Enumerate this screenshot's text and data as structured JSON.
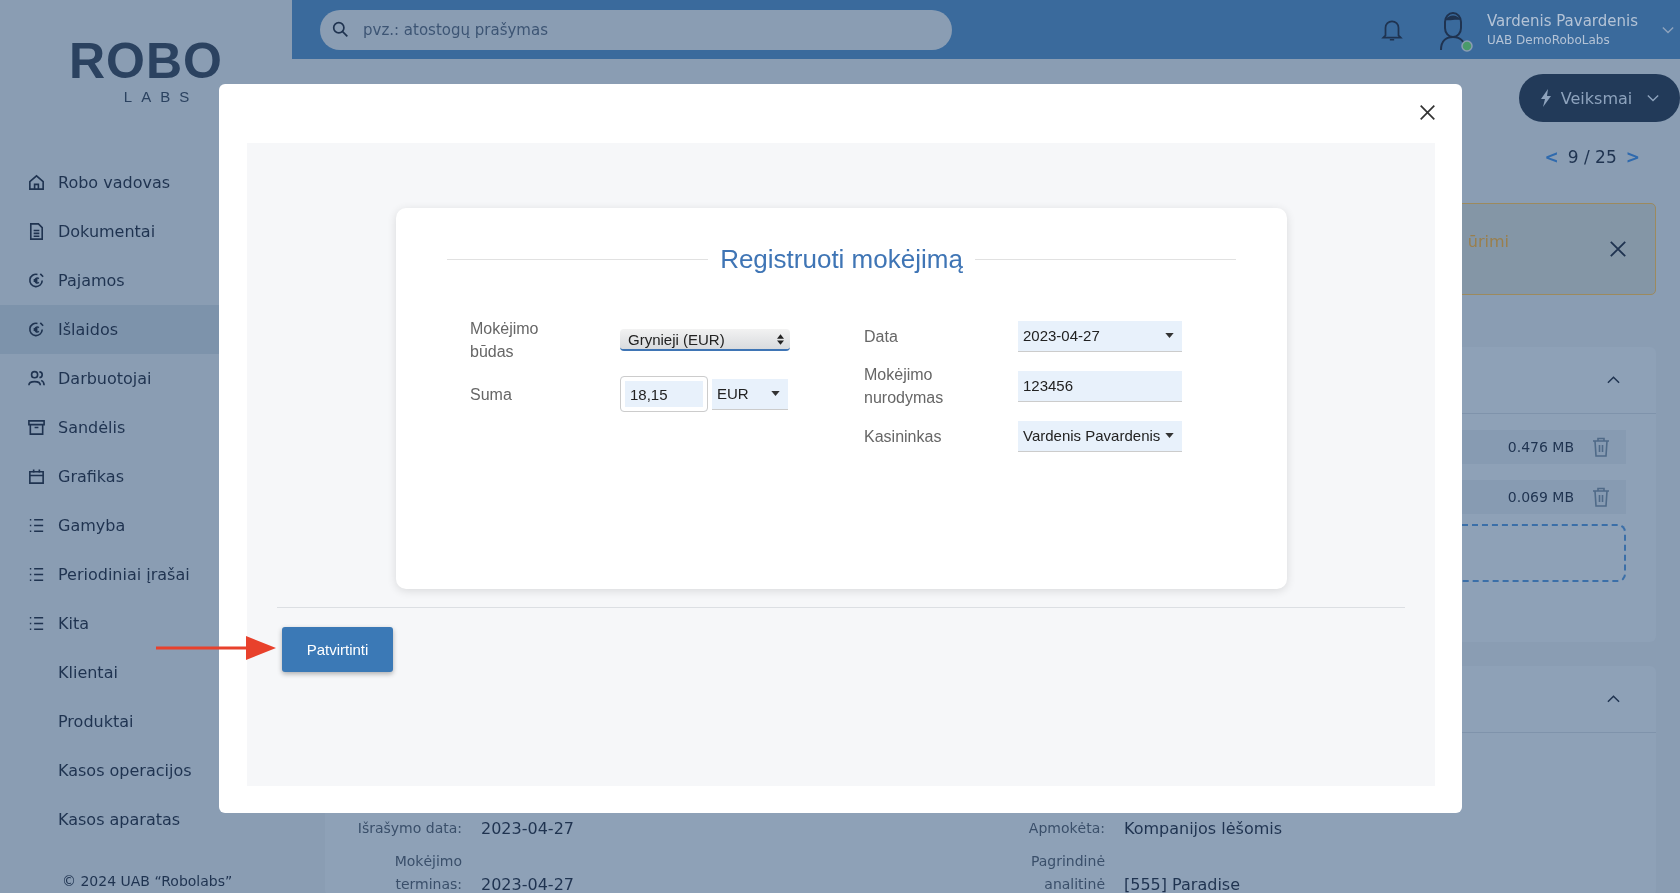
{
  "sidebar": {
    "logo": {
      "word": "ROBO",
      "subword": "LABS"
    },
    "items": [
      {
        "label": "Robo vadovas",
        "selected": false
      },
      {
        "label": "Dokumentai",
        "selected": false
      },
      {
        "label": "Pajamos",
        "selected": false
      },
      {
        "label": "Išlaidos",
        "selected": true
      },
      {
        "label": "Darbuotojai",
        "selected": false
      },
      {
        "label": "Sandėlis",
        "selected": false
      },
      {
        "label": "Grafikas",
        "selected": false
      },
      {
        "label": "Gamyba",
        "selected": false
      },
      {
        "label": "Periodiniai įrašai",
        "selected": false
      },
      {
        "label": "Kita",
        "selected": false,
        "children": [
          {
            "label": "Klientai",
            "selected": false
          },
          {
            "label": "Produktai",
            "selected": false
          },
          {
            "label": "Kasos operacijos",
            "selected": false
          },
          {
            "label": "Kasos aparatas",
            "selected": false
          }
        ]
      }
    ],
    "copyright": "© 2024 UAB “Robolabs”"
  },
  "topbar": {
    "search": {
      "placeholder": "pvz.: atostogų prašymas"
    },
    "user": {
      "name": "Vardenis Pavardenis",
      "company": "UAB DemoRoboLabs"
    }
  },
  "actions_button": "Veiksmai",
  "pager": {
    "prev": "<",
    "position": "9 / 25",
    "next": ">"
  },
  "alert": {
    "text": "ūrimi"
  },
  "files": [
    {
      "size": "0.476 MB"
    },
    {
      "size": "0.069 MB"
    }
  ],
  "details": [
    [
      {
        "label": "Išrašymo data:",
        "value": "2023-04-27"
      },
      {
        "label": "Mokėjimo terminas:",
        "value": "2023-04-27"
      }
    ],
    [
      {
        "label": "Apmokėta:",
        "value": "Kompanijos lėšomis"
      },
      {
        "label": "Pagrindinė analitinė",
        "value": "[555] Paradise"
      }
    ]
  ],
  "modal": {
    "title": "Registruoti mokėjimą",
    "left_fields": [
      {
        "kind": "select",
        "label": "Mokėjimo būdas",
        "value": "Grynieji (EUR)"
      },
      {
        "kind": "amount",
        "label": "Suma",
        "value": "18,15",
        "currency": "EUR"
      }
    ],
    "right_fields": [
      {
        "kind": "dropdown",
        "label": "Data",
        "value": "2023-04-27"
      },
      {
        "kind": "input",
        "label": "Mokėjimo nurodymas",
        "value": "123456"
      },
      {
        "kind": "dropdown",
        "label": "Kasininkas",
        "value": "Vardenis Pavardenis"
      }
    ],
    "confirm_button": "Patvirtinti"
  }
}
